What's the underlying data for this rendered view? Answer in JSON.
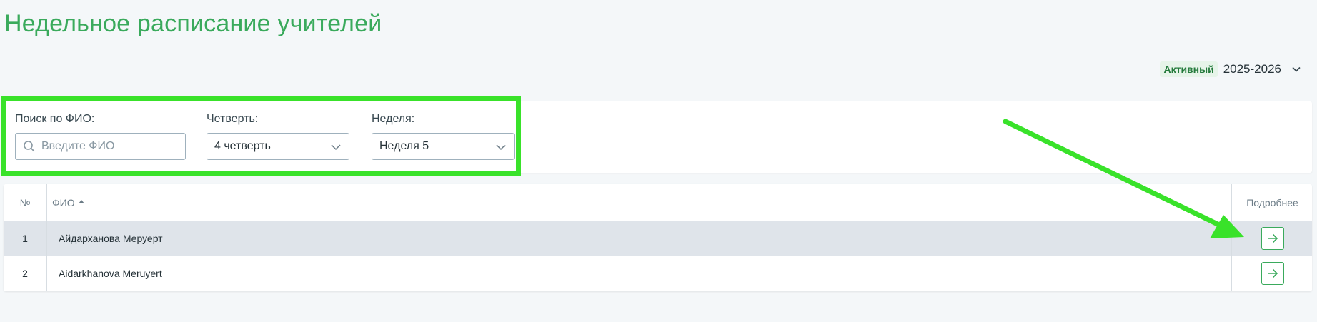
{
  "page": {
    "title": "Недельное расписание учителей"
  },
  "year_selector": {
    "status_badge": "Активный",
    "value": "2025-2026"
  },
  "filters": {
    "search": {
      "label": "Поиск по ФИО:",
      "placeholder": "Введите ФИО",
      "value": ""
    },
    "quarter": {
      "label": "Четверть:",
      "value": "4 четверть"
    },
    "week": {
      "label": "Неделя:",
      "value": "Неделя 5"
    }
  },
  "table": {
    "columns": {
      "num": "№",
      "name": "ФИО",
      "details": "Подробнее"
    },
    "rows": [
      {
        "num": "1",
        "name": "Айдарханова Меруерт"
      },
      {
        "num": "2",
        "name": "Aidarkhanova Meruyert"
      }
    ]
  },
  "colors": {
    "accent": "#3aaa5c",
    "highlight": "#39e22a",
    "row_selected": "#dfe4ea"
  }
}
